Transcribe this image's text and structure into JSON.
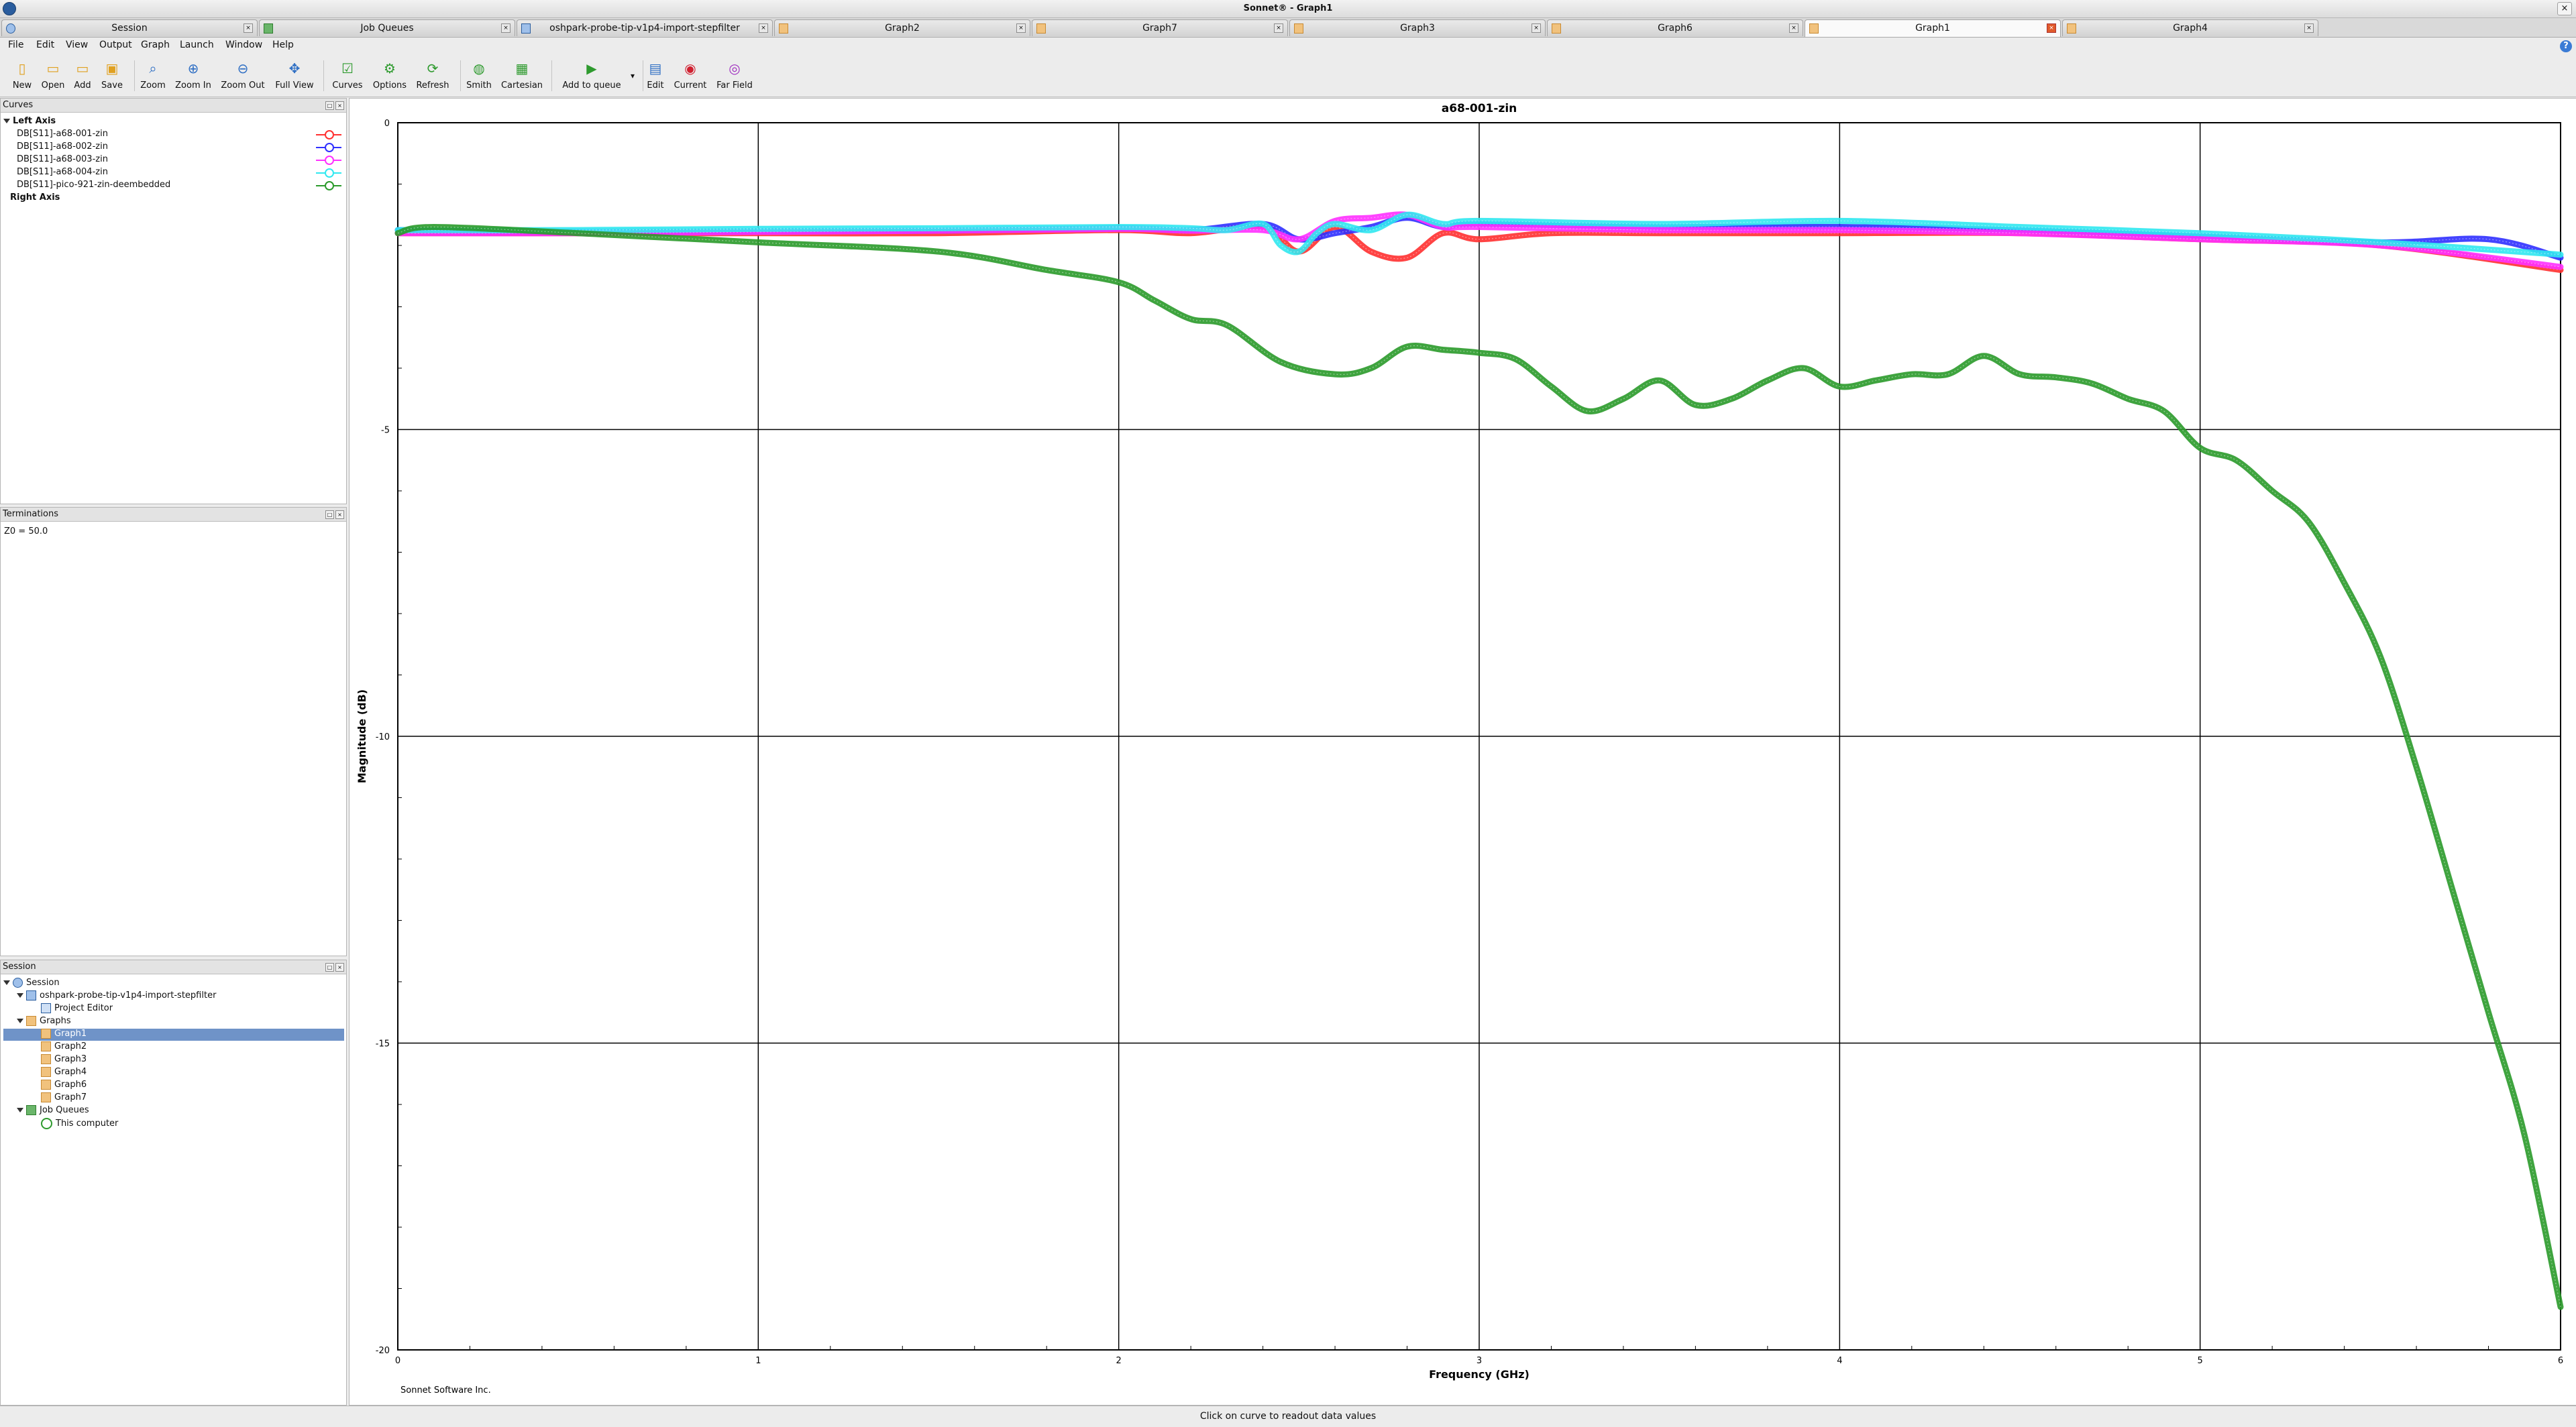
{
  "window": {
    "title": "Sonnet® - Graph1",
    "close": "×"
  },
  "tabs": [
    {
      "label": "Session"
    },
    {
      "label": "Job Queues"
    },
    {
      "label": "oshpark-probe-tip-v1p4-import-stepfilter"
    },
    {
      "label": "Graph2"
    },
    {
      "label": "Graph7"
    },
    {
      "label": "Graph3"
    },
    {
      "label": "Graph6"
    },
    {
      "label": "Graph1"
    },
    {
      "label": "Graph4"
    }
  ],
  "menu": [
    "File",
    "Edit",
    "View",
    "Output",
    "Graph",
    "Launch",
    "Window",
    "Help"
  ],
  "toolbar": [
    "New",
    "Open",
    "Add",
    "Save",
    "Zoom",
    "Zoom In",
    "Zoom Out",
    "Full View",
    "Curves",
    "Options",
    "Refresh",
    "Smith",
    "Cartesian",
    "Add to queue",
    "Edit",
    "Current",
    "Far Field"
  ],
  "curves_panel": {
    "title": "Curves",
    "left_axis": "Left Axis",
    "right_axis": "Right Axis",
    "curves": [
      {
        "label": "DB[S11]-a68-001-zin",
        "color": "#ff3030"
      },
      {
        "label": "DB[S11]-a68-002-zin",
        "color": "#3030ff"
      },
      {
        "label": "DB[S11]-a68-003-zin",
        "color": "#ff30ff"
      },
      {
        "label": "DB[S11]-a68-004-zin",
        "color": "#30e8f0"
      },
      {
        "label": "DB[S11]-pico-921-zin-deembedded",
        "color": "#2a9a2a"
      }
    ]
  },
  "terminations_panel": {
    "title": "Terminations",
    "text": "Z0 = 50.0"
  },
  "session_panel": {
    "title": "Session",
    "root": "Session",
    "project": "oshpark-probe-tip-v1p4-import-stepfilter",
    "project_editor": "Project Editor",
    "graphs_label": "Graphs",
    "graphs": [
      "Graph1",
      "Graph2",
      "Graph3",
      "Graph4",
      "Graph6",
      "Graph7"
    ],
    "job_queues": "Job Queues",
    "this_computer": "This computer"
  },
  "chart_data": {
    "type": "line",
    "title": "a68-001-zin",
    "xlabel": "Frequency (GHz)",
    "ylabel": "Magnitude (dB)",
    "xlim": [
      0,
      6
    ],
    "ylim": [
      -20,
      0
    ],
    "xticks": [
      "0",
      "1",
      "2",
      "3",
      "4",
      "5",
      "6"
    ],
    "yticks": [
      "0",
      "-5",
      "-10",
      "-15",
      "-20"
    ],
    "grid": true,
    "footer": "Sonnet Software Inc.",
    "series": [
      {
        "name": "DB[S11]-a68-001-zin",
        "color": "#ff3030",
        "x": [
          0,
          0.5,
          1,
          1.5,
          2,
          2.2,
          2.4,
          2.5,
          2.6,
          2.7,
          2.8,
          2.9,
          3.0,
          3.2,
          3.5,
          4,
          4.5,
          5,
          5.5,
          6
        ],
        "y": [
          -1.8,
          -1.8,
          -1.8,
          -1.8,
          -1.75,
          -1.8,
          -1.7,
          -2.1,
          -1.7,
          -2.1,
          -2.2,
          -1.8,
          -1.9,
          -1.8,
          -1.8,
          -1.8,
          -1.8,
          -1.9,
          -2.0,
          -2.4
        ]
      },
      {
        "name": "DB[S11]-a68-002-zin",
        "color": "#3030ff",
        "x": [
          0,
          0.5,
          1,
          1.5,
          2,
          2.2,
          2.4,
          2.5,
          2.6,
          2.7,
          2.8,
          2.9,
          3.0,
          3.5,
          4,
          4.5,
          5,
          5.5,
          5.8,
          6
        ],
        "y": [
          -1.75,
          -1.78,
          -1.77,
          -1.76,
          -1.72,
          -1.75,
          -1.65,
          -1.9,
          -1.8,
          -1.7,
          -1.55,
          -1.7,
          -1.65,
          -1.7,
          -1.7,
          -1.75,
          -1.85,
          -1.95,
          -1.9,
          -2.2
        ]
      },
      {
        "name": "DB[S11]-a68-003-zin",
        "color": "#ff30ff",
        "x": [
          0,
          0.5,
          1,
          1.5,
          2,
          2.2,
          2.4,
          2.5,
          2.6,
          2.7,
          2.8,
          2.9,
          3.0,
          3.5,
          4,
          4.5,
          5,
          5.5,
          6
        ],
        "y": [
          -1.8,
          -1.8,
          -1.78,
          -1.76,
          -1.73,
          -1.76,
          -1.75,
          -1.9,
          -1.6,
          -1.55,
          -1.5,
          -1.7,
          -1.7,
          -1.75,
          -1.75,
          -1.8,
          -1.9,
          -2.0,
          -2.35
        ]
      },
      {
        "name": "DB[S11]-a68-004-zin",
        "color": "#30e8f0",
        "x": [
          0,
          0.5,
          1,
          1.5,
          2,
          2.2,
          2.3,
          2.4,
          2.45,
          2.5,
          2.55,
          2.6,
          2.7,
          2.8,
          2.9,
          3.0,
          3.5,
          4,
          4.5,
          5,
          5.5,
          6
        ],
        "y": [
          -1.75,
          -1.75,
          -1.73,
          -1.72,
          -1.7,
          -1.72,
          -1.75,
          -1.65,
          -2.0,
          -2.1,
          -1.8,
          -1.65,
          -1.75,
          -1.5,
          -1.65,
          -1.6,
          -1.65,
          -1.6,
          -1.7,
          -1.8,
          -1.95,
          -2.15
        ]
      },
      {
        "name": "DB[S11]-pico-921-zin-deembedded",
        "color": "#2a9a2a",
        "x": [
          0,
          0.1,
          0.5,
          1,
          1.5,
          1.8,
          2.0,
          2.1,
          2.2,
          2.3,
          2.45,
          2.6,
          2.7,
          2.8,
          2.9,
          3.0,
          3.1,
          3.2,
          3.3,
          3.4,
          3.5,
          3.6,
          3.7,
          3.8,
          3.9,
          4.0,
          4.1,
          4.2,
          4.3,
          4.4,
          4.5,
          4.6,
          4.7,
          4.8,
          4.9,
          5.0,
          5.1,
          5.2,
          5.3,
          5.4,
          5.5,
          5.6,
          5.7,
          5.8,
          5.9,
          6.0
        ],
        "y": [
          -1.8,
          -1.7,
          -1.8,
          -1.95,
          -2.1,
          -2.4,
          -2.6,
          -2.9,
          -3.2,
          -3.3,
          -3.9,
          -4.1,
          -4.0,
          -3.65,
          -3.7,
          -3.75,
          -3.85,
          -4.3,
          -4.7,
          -4.5,
          -4.2,
          -4.6,
          -4.5,
          -4.2,
          -4.0,
          -4.3,
          -4.2,
          -4.1,
          -4.1,
          -3.8,
          -4.1,
          -4.15,
          -4.25,
          -4.5,
          -4.7,
          -5.3,
          -5.5,
          -6.0,
          -6.5,
          -7.5,
          -8.7,
          -10.5,
          -12.5,
          -14.5,
          -16.5,
          -19.3
        ]
      }
    ]
  },
  "status": "Click on curve to readout data values"
}
